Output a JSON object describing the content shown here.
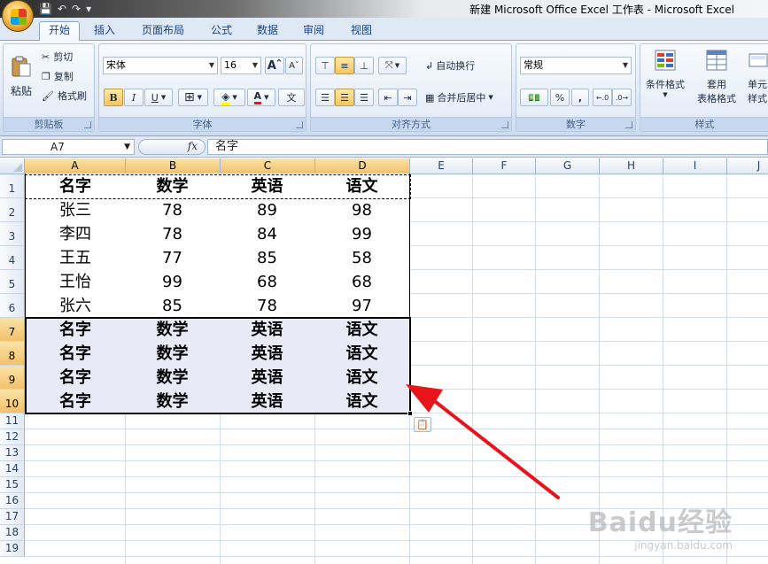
{
  "window": {
    "title": "新建 Microsoft Office Excel 工作表 - Microsoft Excel"
  },
  "ribbon": {
    "tabs": [
      {
        "label": "开始",
        "active": true
      },
      {
        "label": "插入",
        "active": false
      },
      {
        "label": "页面布局",
        "active": false
      },
      {
        "label": "公式",
        "active": false
      },
      {
        "label": "数据",
        "active": false
      },
      {
        "label": "审阅",
        "active": false
      },
      {
        "label": "视图",
        "active": false
      }
    ],
    "clipboard": {
      "group_label": "剪贴板",
      "paste": "粘贴",
      "cut": "剪切",
      "copy": "复制",
      "format_painter": "格式刷"
    },
    "font": {
      "group_label": "字体",
      "font_name": "宋体",
      "font_size": "16",
      "bold": "B",
      "italic": "I",
      "underline": "U"
    },
    "alignment": {
      "group_label": "对齐方式",
      "wrap_text": "自动换行",
      "merge_center": "合并后居中"
    },
    "number": {
      "group_label": "数字",
      "format": "常规",
      "percent": "%",
      "comma": ","
    },
    "styles": {
      "group_label": "样式",
      "conditional_formatting": "条件格式",
      "format_as_table_line1": "套用",
      "format_as_table_line2": "表格格式",
      "cell_styles_line1": "单元",
      "cell_styles_line2": "样式"
    }
  },
  "formula_bar": {
    "name_box": "A7",
    "fx": "fx",
    "content": "名字"
  },
  "sheet": {
    "columns": [
      "A",
      "B",
      "C",
      "D",
      "E",
      "F",
      "G",
      "H",
      "I",
      "J"
    ],
    "rows": [
      "1",
      "2",
      "3",
      "4",
      "5",
      "6",
      "7",
      "8",
      "9",
      "10",
      "11",
      "12",
      "13",
      "14",
      "15",
      "16",
      "17",
      "18",
      "19"
    ],
    "cells": [
      [
        "名字",
        "数学",
        "英语",
        "语文"
      ],
      [
        "张三",
        "78",
        "89",
        "98"
      ],
      [
        "李四",
        "78",
        "84",
        "99"
      ],
      [
        "王五",
        "77",
        "85",
        "58"
      ],
      [
        "王怡",
        "99",
        "68",
        "68"
      ],
      [
        "张六",
        "85",
        "78",
        "97"
      ],
      [
        "名字",
        "数学",
        "英语",
        "语文"
      ],
      [
        "名字",
        "数学",
        "英语",
        "语文"
      ],
      [
        "名字",
        "数学",
        "英语",
        "语文"
      ],
      [
        "名字",
        "数学",
        "英语",
        "语文"
      ]
    ]
  },
  "watermark": {
    "brand": "Baidu经验",
    "url": "jingyan.baidu.com"
  },
  "colors": {
    "accent": "#f3c16a",
    "selection_fill": "#e8ebf6",
    "arrow": "#e8141b"
  }
}
